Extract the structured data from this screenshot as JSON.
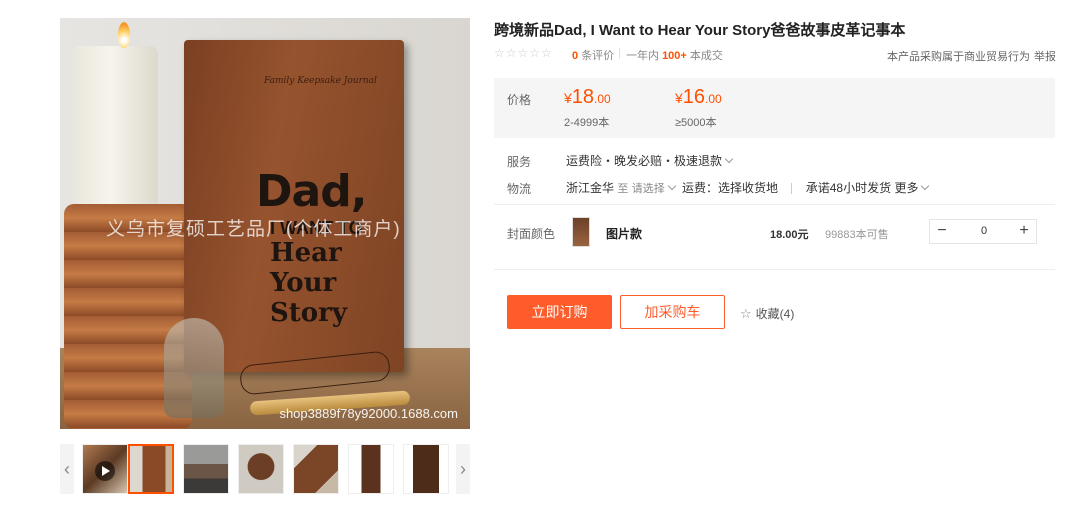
{
  "gallery": {
    "main_image": {
      "watermark": "义乌市复硕工艺品厂(个体工商户)",
      "shop_url": "shop3889f78y92000.1688.com",
      "book_text": {
        "small": "Family Keepsake Journal",
        "line1": "Dad,",
        "line2": "I WANT TO",
        "line3": "Hear",
        "line4": "Your",
        "line5": "Story"
      }
    },
    "thumbnails": [
      {
        "type": "video",
        "selected": false
      },
      {
        "type": "image",
        "selected": true
      },
      {
        "type": "image",
        "selected": false
      },
      {
        "type": "image",
        "selected": false
      },
      {
        "type": "image",
        "selected": false
      },
      {
        "type": "image",
        "selected": false
      },
      {
        "type": "image",
        "selected": false
      }
    ],
    "prev_icon": "chevron-left-icon",
    "next_icon": "chevron-right-icon"
  },
  "product": {
    "title": "跨境新品Dad, I Want to Hear Your Story爸爸故事皮革记事本",
    "review_count": "0",
    "review_label": "条评价",
    "sold_prefix": "一年内",
    "sold_count": "100+",
    "sold_suffix": "本成交",
    "trade_note": "本产品采购属于商业贸易行为",
    "report": "举报"
  },
  "pricing": {
    "label": "价格",
    "tiers": [
      {
        "currency": "¥",
        "int": "18",
        "dec": ".00",
        "range": "2-4999本"
      },
      {
        "currency": "¥",
        "int": "16",
        "dec": ".00",
        "range": "≥5000本"
      }
    ]
  },
  "service": {
    "label": "服务",
    "text": "运费险・晚发必赔・极速退款"
  },
  "logistics": {
    "label": "物流",
    "origin": "浙江金华",
    "to": "至",
    "select": "请选择",
    "freight": "运费：选择收货地",
    "promise": "承诺48小时发货",
    "more": "更多"
  },
  "sku": {
    "label": "封面颜色",
    "name": "图片款",
    "price": "18.00元",
    "stock": "99883本可售",
    "quantity": "0"
  },
  "actions": {
    "buy": "立即订购",
    "cart": "加采购车",
    "favorite": "收藏(4)"
  },
  "colors": {
    "accent": "#ff5000",
    "button": "#ff5c2b",
    "panel": "#f5f5f5"
  }
}
